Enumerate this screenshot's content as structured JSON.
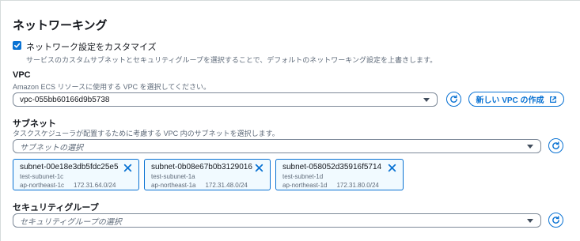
{
  "section": {
    "title": "ネットワーキング",
    "customize": {
      "label": "ネットワーク設定をカスタマイズ",
      "description": "サービスのカスタムサブネットとセキュリティグループを選択することで、デフォルトのネットワーキング設定を上書きします。",
      "checked": true
    }
  },
  "vpc": {
    "label": "VPC",
    "description": "Amazon ECS リソースに使用する VPC を選択してください。",
    "value": "vpc-055bb60166d9b5738",
    "create_button": "新しい VPC の作成"
  },
  "subnets": {
    "label": "サブネット",
    "description": "タスクスケジューラが配置するために考慮する VPC 内のサブネットを選択します。",
    "placeholder": "サブネットの選択",
    "selected": [
      {
        "id": "subnet-00e18e3db5fdc25e5",
        "name": "test-subunet-1c",
        "az": "ap-northeast-1c",
        "cidr": "172.31.64.0/24"
      },
      {
        "id": "subnet-0b08e67b0b3129016",
        "name": "test-subunet-1a",
        "az": "ap-northeast-1a",
        "cidr": "172.31.48.0/24"
      },
      {
        "id": "subnet-058052d35916f5714",
        "name": "test-subnet-1d",
        "az": "ap-northeast-1d",
        "cidr": "172.31.80.0/24"
      }
    ]
  },
  "security_groups": {
    "label": "セキュリティグループ",
    "placeholder": "セキュリティグループの選択"
  },
  "colors": {
    "accent": "#0972d3",
    "token_bg": "#f1faff",
    "secondary_text": "#5f6b7a"
  }
}
